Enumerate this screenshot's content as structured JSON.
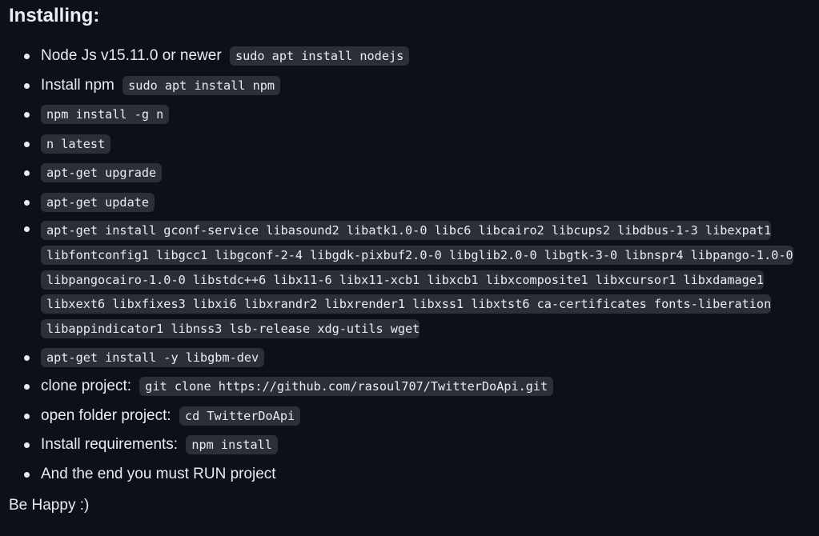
{
  "heading": "Installing:",
  "steps": [
    {
      "text": "Node Js v15.11.0 or newer",
      "code": "sudo apt install nodejs"
    },
    {
      "text": "Install npm",
      "code": "sudo apt install npm"
    },
    {
      "text": "",
      "code": "npm install -g n"
    },
    {
      "text": "",
      "code": "n latest"
    },
    {
      "text": "",
      "code": "apt-get upgrade"
    },
    {
      "text": "",
      "code": "apt-get update"
    },
    {
      "text": "",
      "code": "apt-get install gconf-service libasound2 libatk1.0-0 libc6 libcairo2 libcups2 libdbus-1-3 libexpat1 libfontconfig1 libgcc1 libgconf-2-4 libgdk-pixbuf2.0-0 libglib2.0-0 libgtk-3-0 libnspr4 libpango-1.0-0 libpangocairo-1.0-0 libstdc++6 libx11-6 libx11-xcb1 libxcb1 libxcomposite1 libxcursor1 libxdamage1 libxext6 libxfixes3 libxi6 libxrandr2 libxrender1 libxss1 libxtst6 ca-certificates fonts-liberation libappindicator1 libnss3 lsb-release xdg-utils wget"
    },
    {
      "text": "",
      "code": "apt-get install -y libgbm-dev"
    },
    {
      "text": "clone project:",
      "code": "git clone https://github.com/rasoul707/TwitterDoApi.git"
    },
    {
      "text": "open folder project:",
      "code": "cd TwitterDoApi"
    },
    {
      "text": "Install requirements:",
      "code": "npm install"
    },
    {
      "text": "And the end you must RUN project",
      "code": ""
    }
  ],
  "outro": "Be Happy :)",
  "colors": {
    "background": "#0d1117",
    "text": "#e6edf3",
    "code_background": "#2b3036"
  }
}
